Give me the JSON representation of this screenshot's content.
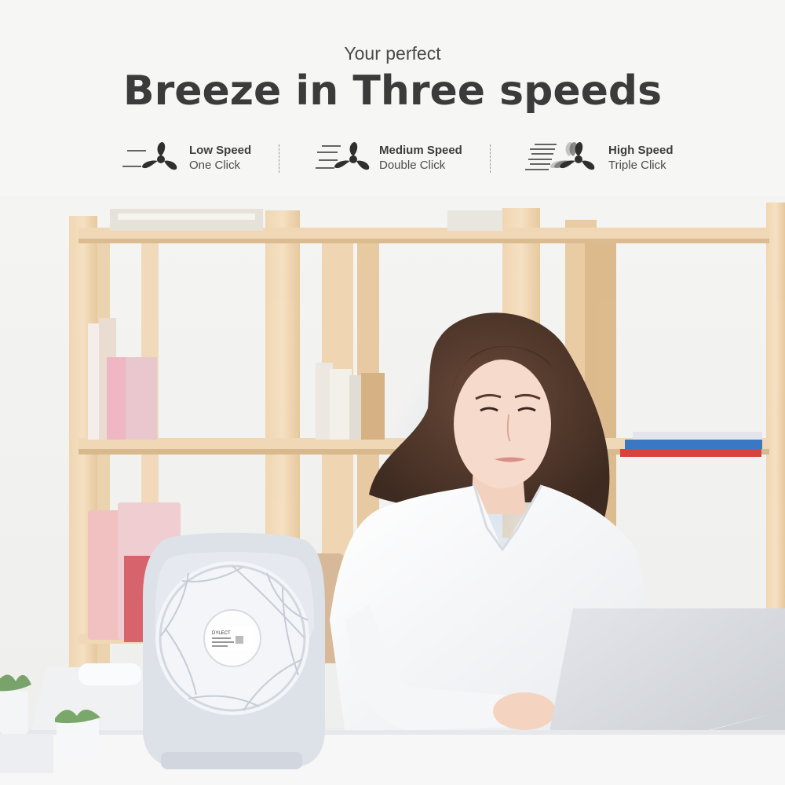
{
  "header": {
    "subtitle": "Your perfect",
    "title": "Breeze in Three speeds"
  },
  "speeds": [
    {
      "name": "Low Speed",
      "action": "One Click",
      "icon": "fan-low-icon"
    },
    {
      "name": "Medium Speed",
      "action": "Double Click",
      "icon": "fan-medium-icon"
    },
    {
      "name": "High Speed",
      "action": "Triple Click",
      "icon": "fan-high-icon"
    }
  ],
  "fan_label": {
    "brand": "DYLECT"
  },
  "colors": {
    "title": "#3b3b3b",
    "text": "#4a4a4a",
    "wood": "#e9c9a0",
    "fan": "#dfe3ea"
  }
}
